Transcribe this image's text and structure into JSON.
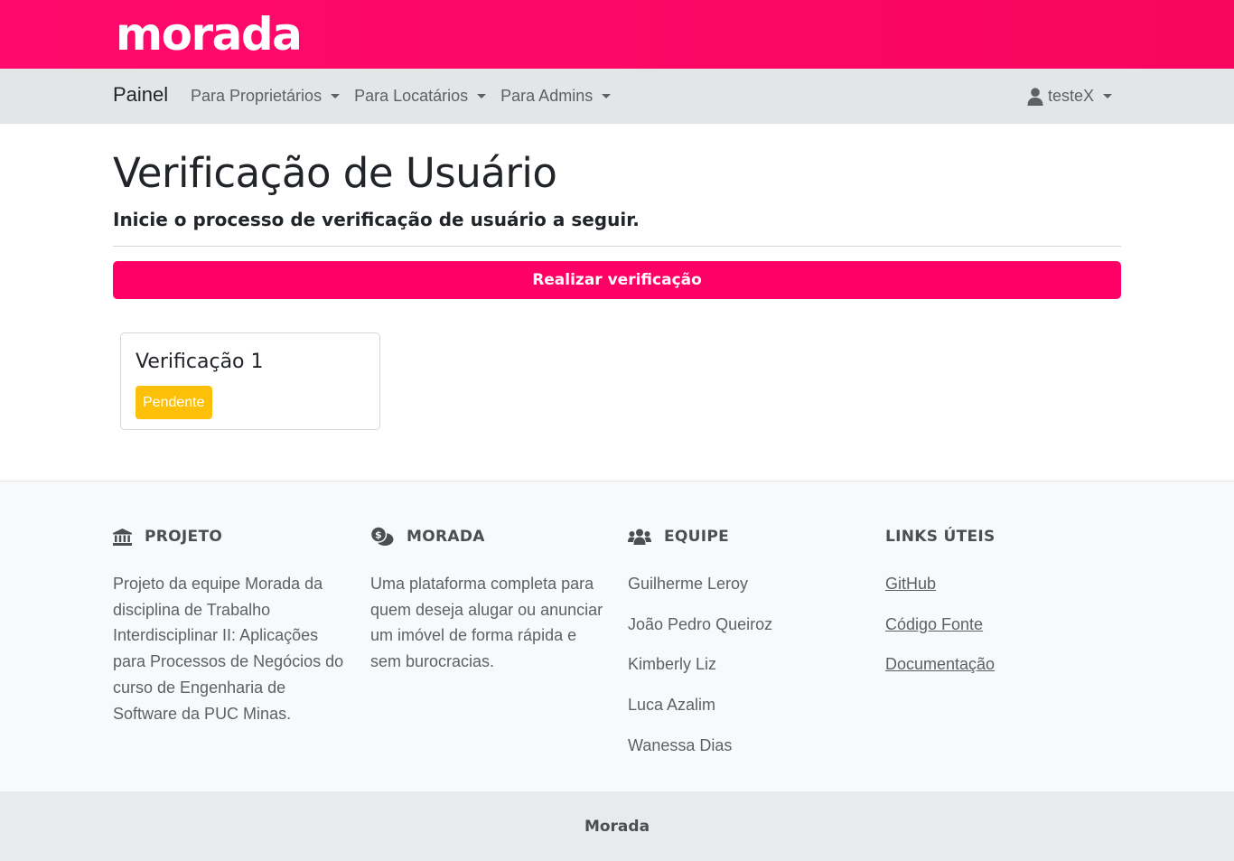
{
  "brand": {
    "logo_text": "morada"
  },
  "navbar": {
    "brand": "Painel",
    "items": [
      {
        "label": "Para Proprietários"
      },
      {
        "label": "Para Locatários"
      },
      {
        "label": "Para Admins"
      }
    ],
    "user": {
      "label": "testeX",
      "icon": "user-icon"
    }
  },
  "main": {
    "title": "Verificação de Usuário",
    "subtitle": "Inicie o processo de verificação de usuário a seguir.",
    "verify_button": "Realizar verificação",
    "cards": [
      {
        "title": "Verificação 1",
        "status": "Pendente",
        "status_color": "#fcc009"
      }
    ]
  },
  "footer": {
    "project": {
      "heading": "PROJETO",
      "icon": "bank-icon",
      "text": "Projeto da equipe Morada da disciplina de Trabalho Interdisciplinar II: Aplicações para Processos de Negócios do curso de Engenharia de Software da PUC Minas."
    },
    "morada": {
      "heading": "MORADA",
      "icon": "money-chat-icon",
      "text": "Uma plataforma completa para quem deseja alugar ou anunciar um imóvel de forma rápida e sem burocracias."
    },
    "team": {
      "heading": "EQUIPE",
      "icon": "users-icon",
      "members": [
        "Guilherme Leroy",
        "João Pedro Queiroz",
        "Kimberly Liz",
        "Luca Azalim",
        "Wanessa Dias"
      ]
    },
    "links": {
      "heading": "LINKS ÚTEIS",
      "items": [
        "GitHub",
        "Código Fonte",
        "Documentação"
      ]
    }
  },
  "copyright": "Morada",
  "colors": {
    "primary": "#ff0066",
    "brandbar": "#ff0a6c",
    "warning": "#fcc009",
    "navbar_bg": "#e4e5e7",
    "footer_bg": "#f8f9fa"
  }
}
